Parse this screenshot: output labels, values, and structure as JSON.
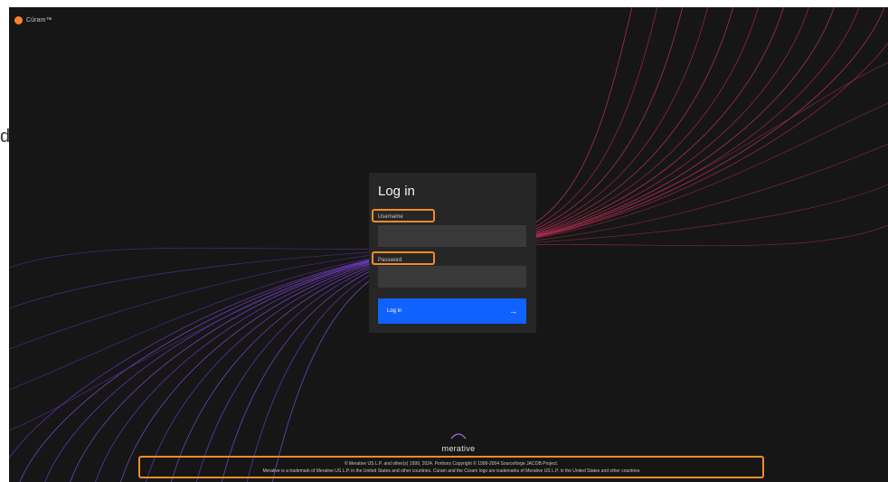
{
  "app": {
    "brand_name": "Cúram™",
    "brand_color": "#ff832b"
  },
  "outside_text": "d",
  "login": {
    "title": "Log in",
    "username_label": "Username",
    "username_value": "",
    "password_label": "Password",
    "password_value": "",
    "submit_label": "Log in",
    "submit_icon": "arrow-right-icon",
    "submit_arrow": "→",
    "accent_color": "#0f62fe"
  },
  "highlight_color": "#f28c28",
  "logo": {
    "text": "merative"
  },
  "footer": {
    "line1": "© Merative US L.P. and other(s) 1999, 2024. Portions Copyright © 1999-2004 Sourceforge JACOB Project.",
    "line2": "Merative is a trademark of Merative US L.P. in the United States and other countries. Cúram and the Cúram logo are trademarks of Merative US L.P. in the United States and other countries"
  }
}
